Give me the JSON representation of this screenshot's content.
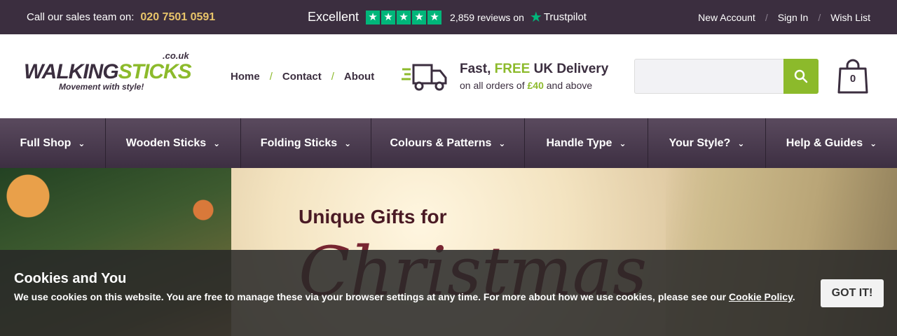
{
  "topbar": {
    "call_label": "Call our sales team on:",
    "phone": "020 7501 0591",
    "rating_word": "Excellent",
    "stars": 5,
    "reviews_text": "2,859 reviews on",
    "trustpilot": "Trustpilot",
    "links": [
      "New Account",
      "Sign In",
      "Wish List"
    ],
    "separator": "/"
  },
  "logo": {
    "walking": "WALKING",
    "sticks": "STICKS",
    "domain": ".co.uk",
    "tagline": "Movement with style!"
  },
  "main_nav": [
    "Home",
    "Contact",
    "About"
  ],
  "delivery": {
    "fast": "Fast,",
    "free": "FREE",
    "uk_delivery": "UK Delivery",
    "line2_pre": "on all orders of",
    "amount": "£40",
    "line2_post": "and above"
  },
  "search": {
    "placeholder": ""
  },
  "cart": {
    "count": "0"
  },
  "categories": [
    "Full Shop",
    "Wooden Sticks",
    "Folding Sticks",
    "Colours & Patterns",
    "Handle Type",
    "Your Style?",
    "Help & Guides"
  ],
  "hero": {
    "heading": "Unique Gifts for",
    "script": "Christmas"
  },
  "cookie": {
    "title": "Cookies and You",
    "text": "We use cookies on this website. You are free to manage these via your browser settings at any time. For more about how we use cookies, please see our",
    "link": "Cookie Policy",
    "end": ".",
    "button": "GOT IT!"
  },
  "colors": {
    "brand_dark": "#3b2e3f",
    "brand_green": "#8cba2b",
    "phone_gold": "#e8c46a",
    "trustpilot_green": "#00b67a"
  }
}
